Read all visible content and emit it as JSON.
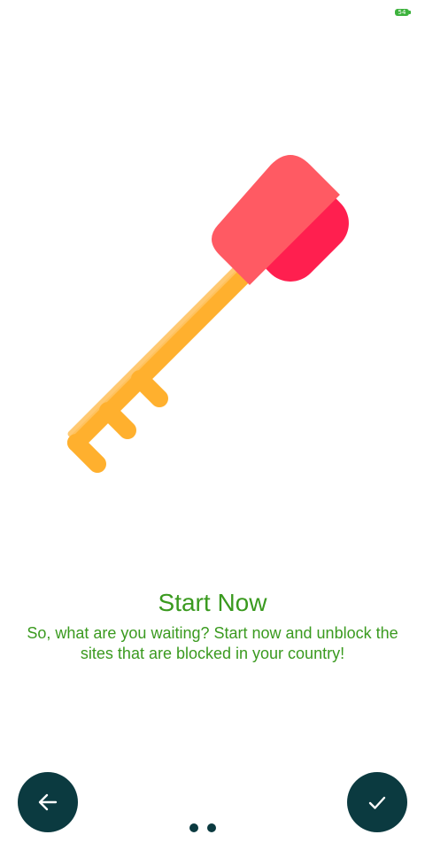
{
  "status_bar": {
    "battery_level": "54",
    "battery_color": "#3db23d"
  },
  "slide": {
    "illustration": "key-icon",
    "title": "Start Now",
    "description": "So, what are you waiting? Start now and unblock the sites that are blocked in your country!",
    "text_color": "#3a9a1f"
  },
  "navigation": {
    "back_icon": "arrow-left-icon",
    "done_icon": "checkmark-icon",
    "button_color": "#0b3a40",
    "page_indicator": {
      "total_pages": 2
    }
  },
  "key_colors": {
    "shaft": "#ffb02e",
    "shaft_highlight": "#ffc463",
    "head_dark": "#ff1f4f",
    "head_light": "#ff5a63"
  }
}
